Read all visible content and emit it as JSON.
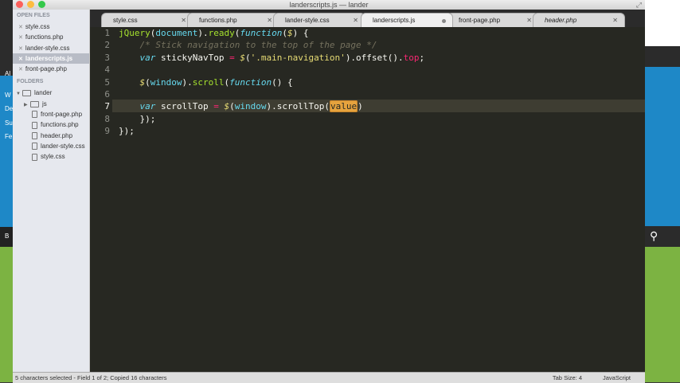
{
  "window": {
    "title": "landerscripts.js — lander"
  },
  "sidebar": {
    "open_files_header": "OPEN FILES",
    "open_files": [
      {
        "label": "style.css",
        "active": false
      },
      {
        "label": "functions.php",
        "active": false
      },
      {
        "label": "lander-style.css",
        "active": false
      },
      {
        "label": "landerscripts.js",
        "active": true
      },
      {
        "label": "front-page.php",
        "active": false
      }
    ],
    "folders_header": "FOLDERS",
    "root_folder": "lander",
    "js_folder": "js",
    "files": [
      "front-page.php",
      "functions.php",
      "header.php",
      "lander-style.css",
      "style.css"
    ]
  },
  "tabs": [
    {
      "label": "style.css"
    },
    {
      "label": "functions.php"
    },
    {
      "label": "lander-style.css"
    },
    {
      "label": "landerscripts.js"
    },
    {
      "label": "front-page.php"
    },
    {
      "label": "header.php"
    }
  ],
  "editor": {
    "line_numbers": [
      "1",
      "2",
      "3",
      "4",
      "5",
      "6",
      "7",
      "8",
      "9"
    ],
    "current_line": 7,
    "selected_text": "value"
  },
  "status": {
    "left": "5 characters selected - Field 1 of 2; Copied 16 characters",
    "tab_size": "Tab Size: 4",
    "syntax": "JavaScript"
  },
  "background": {
    "left_texts": [
      "Al",
      "W",
      "De",
      "Su",
      "Fe",
      "B"
    ]
  },
  "colors": {
    "editor_bg": "#272822",
    "keyword": "#66d9ef",
    "string": "#e6db74",
    "comment": "#75715e",
    "function": "#a6e22e",
    "property": "#f92672",
    "selection": "#e6a33e"
  }
}
